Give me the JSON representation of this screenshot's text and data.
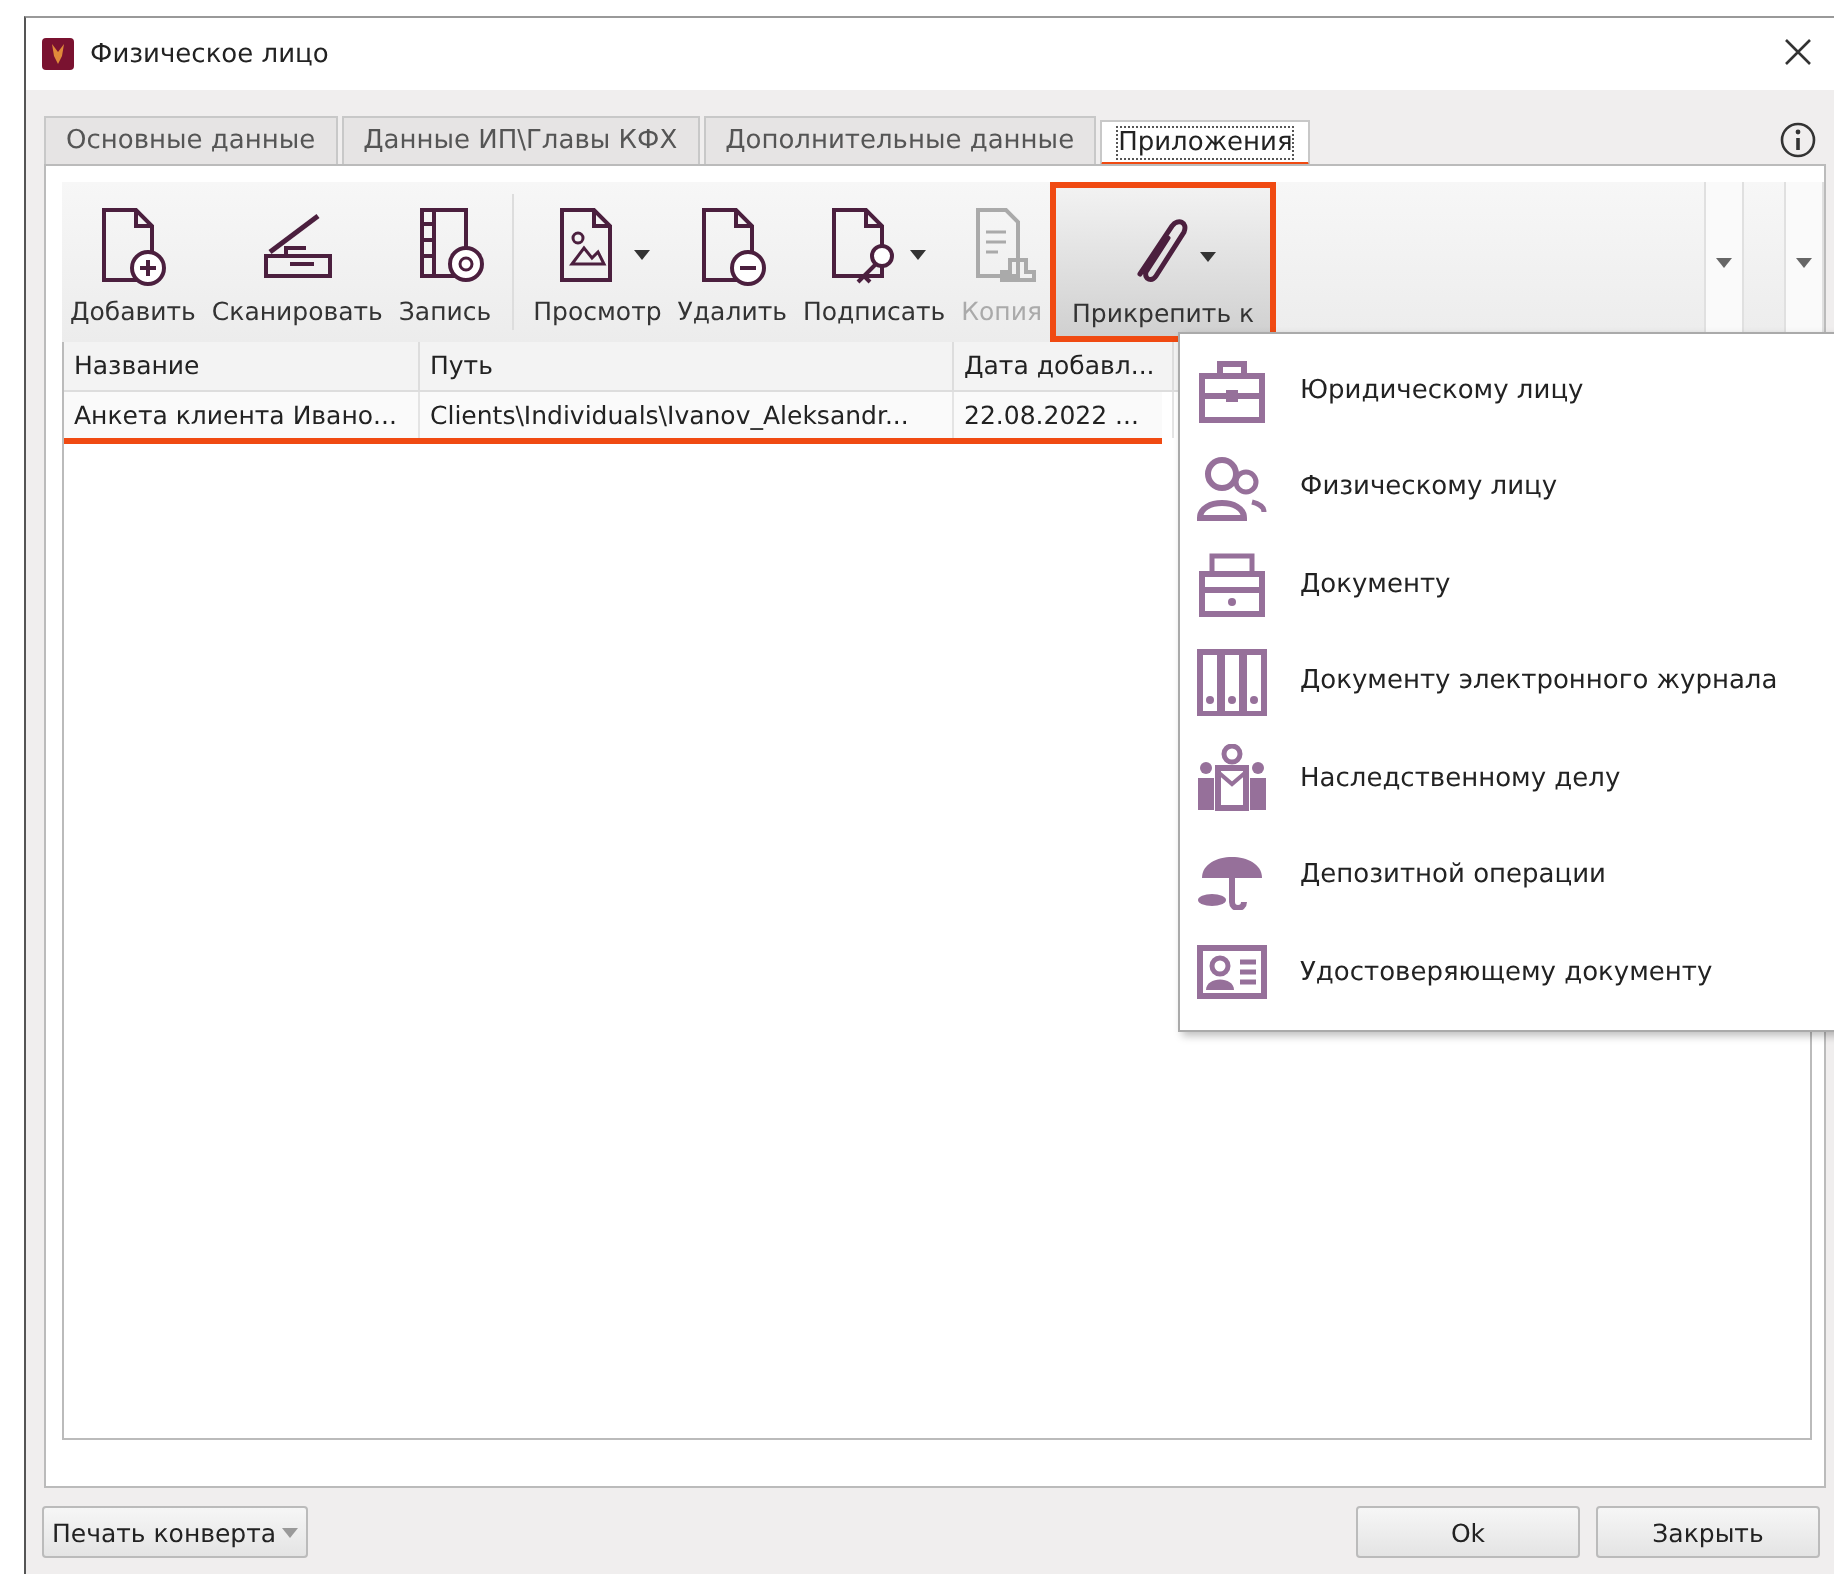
{
  "window": {
    "title": "Физическое лицо"
  },
  "tabs": [
    {
      "label": "Основные данные",
      "selected": false
    },
    {
      "label": "Данные ИП\\Главы КФХ",
      "selected": false
    },
    {
      "label": "Дополнительные данные",
      "selected": false
    },
    {
      "label": "Приложения",
      "selected": true
    }
  ],
  "toolbar": [
    {
      "kind": "add",
      "label": "Добавить",
      "disabled": false,
      "dropdown": false,
      "highlighted": false
    },
    {
      "kind": "scan",
      "label": "Сканировать",
      "disabled": false,
      "dropdown": false,
      "highlighted": false
    },
    {
      "kind": "record",
      "label": "Запись",
      "disabled": false,
      "dropdown": false,
      "highlighted": false
    },
    {
      "kind": "separator"
    },
    {
      "kind": "view",
      "label": "Просмотр",
      "disabled": false,
      "dropdown": true,
      "highlighted": false
    },
    {
      "kind": "delete",
      "label": "Удалить",
      "disabled": false,
      "dropdown": false,
      "highlighted": false
    },
    {
      "kind": "sign",
      "label": "Подписать",
      "disabled": false,
      "dropdown": true,
      "highlighted": false
    },
    {
      "kind": "copy",
      "label": "Копия",
      "disabled": true,
      "dropdown": false,
      "highlighted": false
    },
    {
      "kind": "attach",
      "label": "Прикрепить к",
      "disabled": false,
      "dropdown": true,
      "highlighted": true
    }
  ],
  "table": {
    "columns": [
      "Название",
      "Путь",
      "Дата добавл..."
    ],
    "rows": [
      {
        "cells": [
          "Анкета клиента Ивано...",
          "Clients\\Individuals\\Ivanov_Aleksandr...",
          "22.08.2022 ..."
        ],
        "selected": true
      }
    ]
  },
  "attach_menu": {
    "items": [
      {
        "kind": "company",
        "label": "Юридическому лицу"
      },
      {
        "kind": "person",
        "label": "Физическому лицу"
      },
      {
        "kind": "archive",
        "label": "Документу"
      },
      {
        "kind": "binders",
        "label": "Документу электронного журнала"
      },
      {
        "kind": "family",
        "label": "Наследственному делу"
      },
      {
        "kind": "umbrella",
        "label": "Депозитной операции"
      },
      {
        "kind": "idcard",
        "label": "Удостоверяющему документу"
      }
    ]
  },
  "footer": {
    "envelope_button": "Печать конверта",
    "buttons": [
      "Ok",
      "Закрыть"
    ]
  }
}
